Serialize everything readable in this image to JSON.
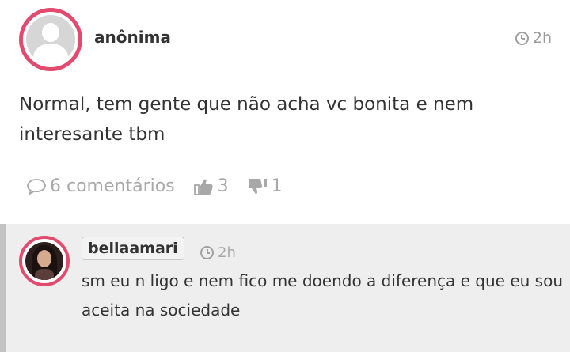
{
  "post": {
    "username": "anônima",
    "time": "2h",
    "text": "Normal, tem gente que não acha vc bonita e nem interesante tbm",
    "comments_label": "6 comentários",
    "likes": "3",
    "dislikes": "1"
  },
  "reply": {
    "username": "bellaamari",
    "time": "2h",
    "text": "sm eu n ligo e nem fico me doendo a diferença e que eu sou aceita na sociedade"
  },
  "icons": {
    "comment": "speech-bubble-icon",
    "like": "thumbs-up-icon",
    "dislike": "thumbs-down-icon",
    "time": "clock-icon"
  },
  "colors": {
    "avatar_ring": "#e24a6e",
    "meta_gray": "#a8a8a8",
    "reply_background": "#eeeeee",
    "reply_border": "#c3c3c3"
  }
}
